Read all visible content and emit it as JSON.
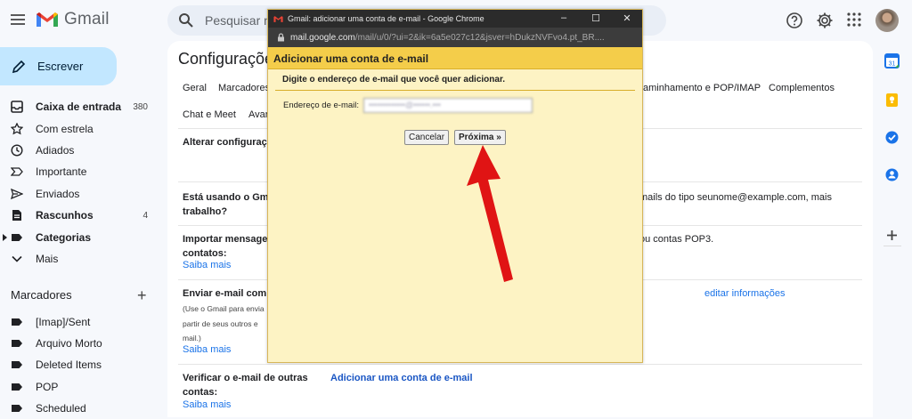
{
  "app": {
    "name": "Gmail"
  },
  "search": {
    "placeholder": "Pesquisar no"
  },
  "sidebar": {
    "compose": "Escrever",
    "items": [
      {
        "label": "Caixa de entrada",
        "count": "380",
        "icon": "inbox-icon"
      },
      {
        "label": "Com estrela",
        "icon": "star-icon"
      },
      {
        "label": "Adiados",
        "icon": "clock-icon"
      },
      {
        "label": "Importante",
        "icon": "label-important-icon"
      },
      {
        "label": "Enviados",
        "icon": "send-icon"
      },
      {
        "label": "Rascunhos",
        "count": "4",
        "icon": "draft-icon"
      },
      {
        "label": "Categorias",
        "icon": "label-icon"
      },
      {
        "label": "Mais",
        "icon": "chevron-down-icon"
      }
    ],
    "labels_heading": "Marcadores",
    "labels": [
      "[Imap]/Sent",
      "Arquivo Morto",
      "Deleted Items",
      "POP",
      "Scheduled"
    ]
  },
  "main": {
    "title": "Configuraçõe",
    "tabs": [
      "Geral",
      "Marcadores",
      "aminhamento e POP/IMAP",
      "Complementos",
      "Chat e Meet",
      "Avar"
    ],
    "rows": {
      "change": "Alterar configuraç",
      "using_1": "Está usando o Gma",
      "using_2": "trabalho?",
      "using_right_1": "mails do tipo seunome@example.com, mais",
      "import_1": "Importar mensage",
      "import_2": "contatos:",
      "import_right": "ou contas POP3.",
      "learn_more": "Saiba mais",
      "send_1": "Enviar e-mail com",
      "send_desc_1": "(Use o Gmail para envia",
      "send_desc_2": "partir de seus outros e",
      "send_desc_3": "mail.)",
      "edit_info": "editar informações",
      "verify_1": "Verificar o e-mail de outras",
      "verify_2": "contas:",
      "add_account": "Adicionar uma conta de e-mail"
    }
  },
  "popup": {
    "window_title": "Gmail: adicionar uma conta de e-mail - Google Chrome",
    "window_buttons": [
      "–",
      "☐",
      "✕"
    ],
    "url_host": "mail.google.com",
    "url_rest": "/mail/u/0/?ui=2&ik=6a5e027c12&jsver=hDukzNVFvo4.pt_BR....",
    "header": "Adicionar uma conta de e-mail",
    "instruction": "Digite o endereço de e-mail que você quer adicionar.",
    "email_label": "Endereço de e-mail:",
    "email_value": "•••••••••••••@••••••.•••",
    "cancel": "Cancelar",
    "next": "Próxima »"
  },
  "colors": {
    "accent": "#1a73e8",
    "compose_bg": "#c2e7ff",
    "popup_bg": "#fdf3c4",
    "popup_header": "#f4cd4a",
    "arrow": "#e01414"
  }
}
